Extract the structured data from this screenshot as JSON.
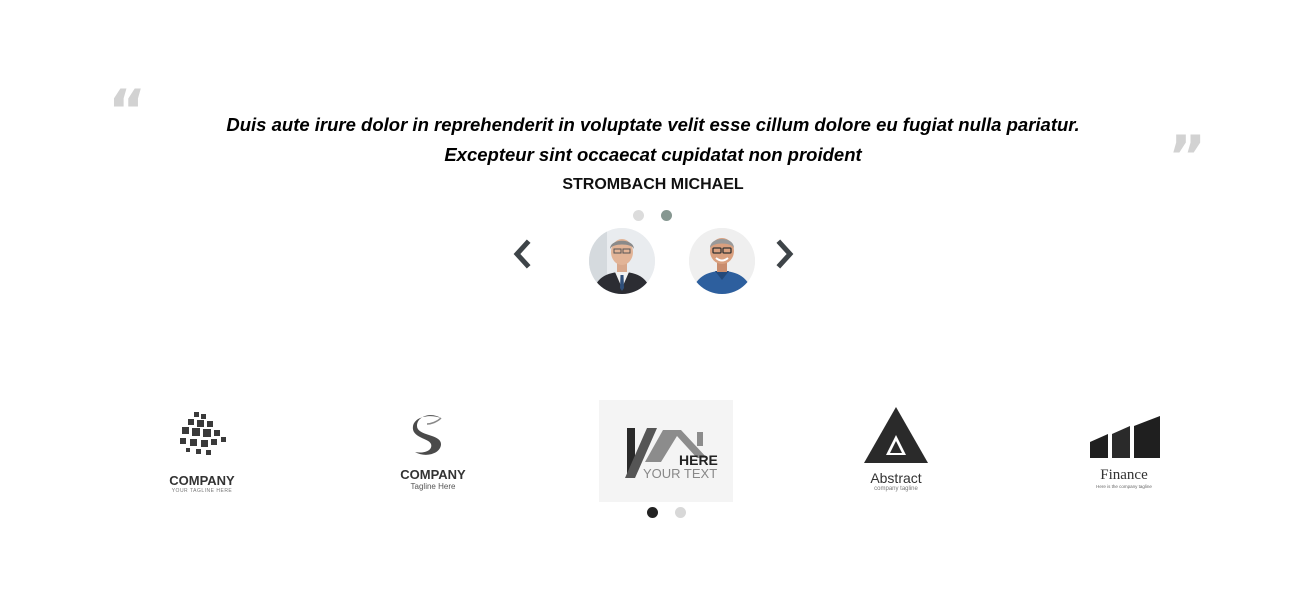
{
  "testimonial": {
    "quote_line_1": "Duis aute irure dolor in reprehenderit in voluptate velit esse cillum dolore eu fugiat nulla pariatur.",
    "quote_line_2": "Excepteur sint occaecat cupidatat non proident",
    "author": "STROMBACH MICHAEL",
    "open_quote": "“",
    "close_quote": "”",
    "active_slide": 2,
    "slide_count": 2
  },
  "logos": [
    {
      "name": "COMPANY",
      "tagline": "YOUR TAGLINE HERE"
    },
    {
      "name": "COMPANY",
      "tagline": "Tagline Here"
    },
    {
      "name": "HERE",
      "tagline": "YOUR TEXT"
    },
    {
      "name": "Abstract",
      "tagline": "company tagline"
    },
    {
      "name": "Finance",
      "tagline": "Here is the company tagline"
    }
  ],
  "logo_carousel": {
    "active_page": 1,
    "page_count": 2
  },
  "icons": {
    "prev": "chevron-left-icon",
    "next": "chevron-right-icon",
    "quote_open": "quote-open-icon",
    "quote_close": "quote-close-icon"
  },
  "colors": {
    "quote_mark": "#d2d2d2",
    "active_testimonial_dot": "#869791",
    "active_logo_dot": "#222222",
    "arrow": "#3e4448"
  }
}
